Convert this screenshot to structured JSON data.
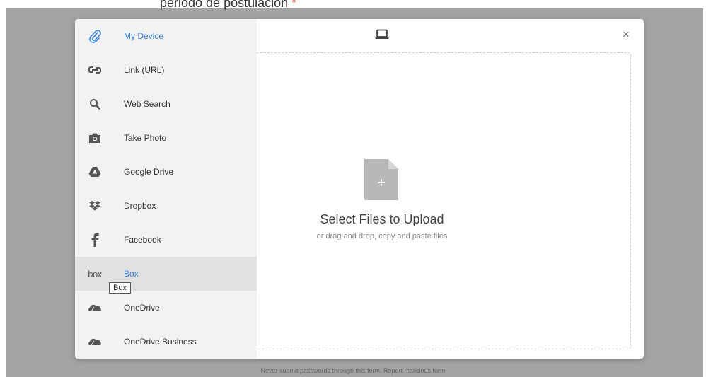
{
  "background": {
    "heading": "periodo de postulación",
    "required_mark": "*",
    "footer": "Never submit passwords through this form. Report malicious form"
  },
  "sidebar": {
    "items": [
      {
        "label": "My Device",
        "icon": "paperclip-icon"
      },
      {
        "label": "Link (URL)",
        "icon": "link-icon"
      },
      {
        "label": "Web Search",
        "icon": "search-icon"
      },
      {
        "label": "Take Photo",
        "icon": "camera-icon"
      },
      {
        "label": "Google Drive",
        "icon": "google-drive-icon"
      },
      {
        "label": "Dropbox",
        "icon": "dropbox-icon"
      },
      {
        "label": "Facebook",
        "icon": "facebook-icon"
      },
      {
        "label": "Box",
        "icon": "box-icon",
        "icon_text": "box"
      },
      {
        "label": "OneDrive",
        "icon": "onedrive-icon"
      },
      {
        "label": "OneDrive Business",
        "icon": "onedrive-business-icon"
      }
    ],
    "active_index": 0,
    "hover_index": 7,
    "tooltip": "Box"
  },
  "header": {
    "icon": "laptop-icon",
    "close_label": "×"
  },
  "dropzone": {
    "icon": "file-add-icon",
    "plus": "+",
    "title": "Select Files to Upload",
    "subtitle": "or drag and drop, copy and paste files"
  },
  "colors": {
    "accent": "#3b84d8",
    "sidebar_bg": "#f2f2f2",
    "hover_bg": "#e2e2e2",
    "overlay": "#5a5a5a"
  }
}
